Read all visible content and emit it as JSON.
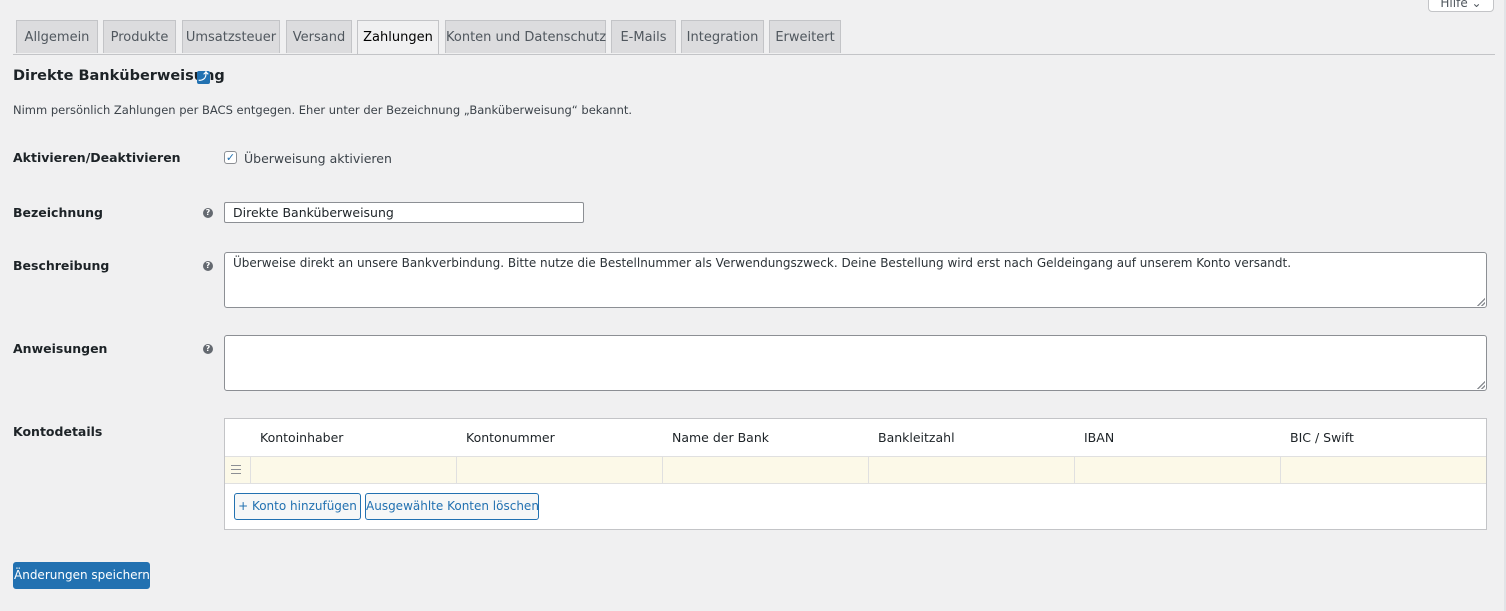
{
  "header": {
    "help_label": "Hilfe ⌄"
  },
  "tabs": [
    {
      "label": "Allgemein",
      "active": false
    },
    {
      "label": "Produkte",
      "active": false
    },
    {
      "label": "Umsatzsteuer",
      "active": false
    },
    {
      "label": "Versand",
      "active": false
    },
    {
      "label": "Zahlungen",
      "active": true
    },
    {
      "label": "Konten und Datenschutz",
      "active": false
    },
    {
      "label": "E-Mails",
      "active": false
    },
    {
      "label": "Integration",
      "active": false
    },
    {
      "label": "Erweitert",
      "active": false
    }
  ],
  "page": {
    "title": "Direkte Banküberweisung",
    "title_link_icon": "external-link-icon",
    "description": "Nimm persönlich Zahlungen per BACS entgegen. Eher unter der Bezeichnung „Banküberweisung“ bekannt."
  },
  "form": {
    "enable": {
      "label": "Aktivieren/Deaktivieren",
      "checkbox_label": "Überweisung aktivieren",
      "checked": true
    },
    "title": {
      "label": "Bezeichnung",
      "value": "Direkte Banküberweisung"
    },
    "description": {
      "label": "Beschreibung",
      "value": "Überweise direkt an unsere Bankverbindung. Bitte nutze die Bestellnummer als Verwendungszweck. Deine Bestellung wird erst nach Geldeingang auf unserem Konto versandt."
    },
    "instructions": {
      "label": "Anweisungen",
      "value": ""
    },
    "accounts": {
      "label": "Kontodetails",
      "columns": [
        "Kontoinhaber",
        "Kontonummer",
        "Name der Bank",
        "Bankleitzahl",
        "IBAN",
        "BIC / Swift"
      ],
      "rows": [
        [
          "",
          "",
          "",
          "",
          "",
          ""
        ]
      ],
      "add_label": "+ Konto hinzufügen",
      "delete_label": "Ausgewählte Konten löschen"
    }
  },
  "save_label": "Änderungen speichern",
  "colors": {
    "accent": "#2271b1",
    "row_highlight": "#fcf9e8",
    "background": "#f0f0f1"
  }
}
